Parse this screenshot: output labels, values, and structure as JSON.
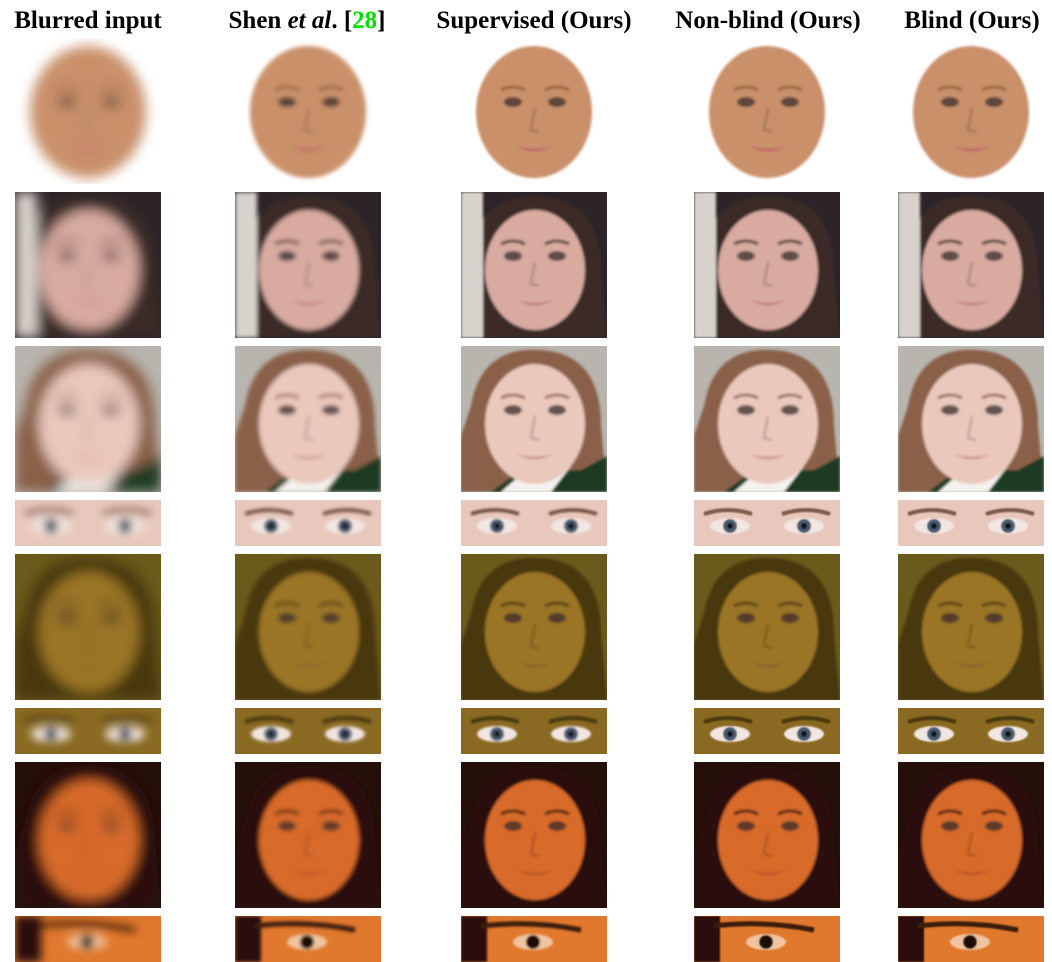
{
  "columns": [
    {
      "id": "blurred",
      "title": "Blurred input"
    },
    {
      "id": "shen",
      "title_pre": "Shen ",
      "title_etal": "et al",
      "title_mid": ". [",
      "title_ref": "28",
      "title_post": "]"
    },
    {
      "id": "supervised",
      "title": "Supervised (Ours)"
    },
    {
      "id": "nonblind",
      "title": "Non-blind (Ours)"
    },
    {
      "id": "blind",
      "title": "Blind (Ours)"
    }
  ],
  "rows": [
    {
      "kind": "face",
      "subject": "man",
      "bg": "#ffffff",
      "skin": "#c9906a",
      "hair": "#8a5a34",
      "lip": "#c04a6a"
    },
    {
      "kind": "face",
      "subject": "woman-with-bangs",
      "bg": "#2c2428",
      "skin": "#d8aaa0",
      "hair": "#3a2a26",
      "lip": "#b86a72"
    },
    {
      "kind": "face",
      "subject": "smiling-girl",
      "bg": "#b8b4ae",
      "skin": "#eac8bc",
      "hair": "#8a6048",
      "lip": "#c07c78"
    },
    {
      "kind": "eyes",
      "subject": "smiling-girl-eyes",
      "bg": "#e8c8bc",
      "skin": "#e8c8bc",
      "hair": "#7a5a48",
      "lip": "#c07c78"
    },
    {
      "kind": "face",
      "subject": "laughing-girl",
      "bg": "#6a5a1c",
      "skin": "#9a7426",
      "hair": "#4a3810",
      "lip": "#8a5a34"
    },
    {
      "kind": "eyes",
      "subject": "laughing-girl-eyes",
      "bg": "#8a6a22",
      "skin": "#8a6a22",
      "hair": "#4a3810",
      "lip": "#8a5a34"
    },
    {
      "kind": "face",
      "subject": "woman-orange",
      "bg": "#241008",
      "skin": "#d86a2c",
      "hair": "#2a1008",
      "lip": "#b04a2a"
    },
    {
      "kind": "eyes",
      "subject": "woman-orange-eye",
      "bg": "#e0782e",
      "skin": "#e0782e",
      "hair": "#2a1008",
      "lip": "#b04a2a"
    }
  ],
  "colors": {
    "reference_green": "#00e000"
  }
}
